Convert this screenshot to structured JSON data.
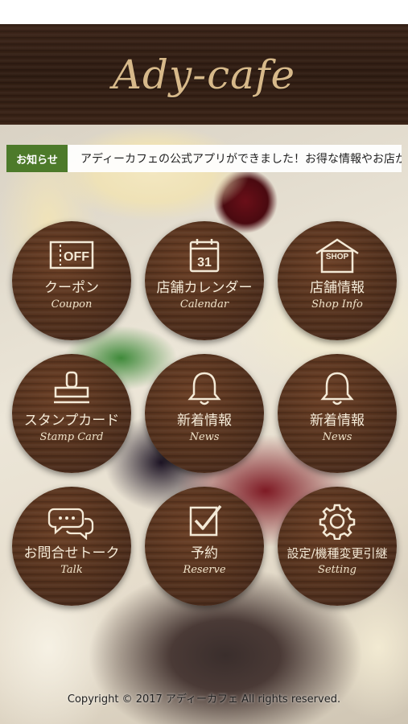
{
  "app": {
    "logo_text": "Ady-cafe"
  },
  "notice": {
    "tag": "お知らせ",
    "text": "アディーカフェの公式アプリができました！お得な情報やお店か"
  },
  "menu": [
    {
      "label": "クーポン",
      "sub": "Coupon",
      "icon": "coupon-off-icon",
      "icon_text": "OFF"
    },
    {
      "label": "店舗カレンダー",
      "sub": "Calendar",
      "icon": "calendar-icon",
      "icon_text": "31"
    },
    {
      "label": "店舗情報",
      "sub": "Shop Info",
      "icon": "shop-icon",
      "icon_text": "SHOP"
    },
    {
      "label": "スタンプカード",
      "sub": "Stamp Card",
      "icon": "stamp-icon"
    },
    {
      "label": "新着情報",
      "sub": "News",
      "icon": "bell-icon"
    },
    {
      "label": "新着情報",
      "sub": "News",
      "icon": "bell-icon"
    },
    {
      "label": "お問合せトーク",
      "sub": "Talk",
      "icon": "chat-bubbles-icon"
    },
    {
      "label": "予約",
      "sub": "Reserve",
      "icon": "checkbox-icon"
    },
    {
      "label": "設定/機種変更引継",
      "sub": "Setting",
      "icon": "gear-icon"
    }
  ],
  "footer": {
    "copyright": "Copyright © 2017 アディーカフェ All rights reserved."
  },
  "colors": {
    "notice_tag": "#4d7a2a",
    "wood": "#52301c",
    "text_light": "#f4ead7"
  }
}
